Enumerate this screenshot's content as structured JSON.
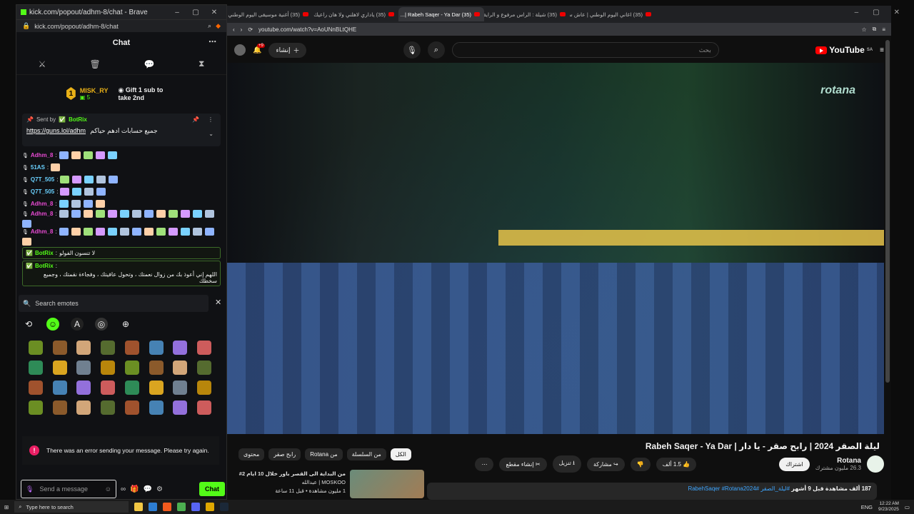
{
  "kick_window": {
    "title": "kick.com/popout/adhm-8/chat - Brave",
    "url": "kick.com/popout/adhm-8/chat"
  },
  "chat": {
    "header": "Chat",
    "gift": {
      "rank": "1",
      "user": "MISK_RY",
      "count": "5",
      "text": "Gift 1 sub to take 2nd"
    },
    "pinned": {
      "sent_by": "Sent by",
      "bot": "BotRix",
      "link": "https://guns.lol/adhm",
      "arabic": "جميع حسابات ادهم حياكم"
    },
    "messages": [
      {
        "user": "Adhm_8",
        "color": "#e64ad1",
        "emotes": 5
      },
      {
        "user": "51AS",
        "color": "#6ad1ff",
        "emotes": 1
      },
      {
        "user": "Q7T_505",
        "color": "#6ad1ff",
        "emotes": 5
      },
      {
        "user": "Q7T_505",
        "color": "#6ad1ff",
        "emotes": 4
      },
      {
        "user": "Adhm_8",
        "color": "#e64ad1",
        "emotes": 4
      },
      {
        "user": "Adhm_8",
        "color": "#e64ad1",
        "emotes": 14
      },
      {
        "user": "Adhm_8",
        "color": "#e64ad1",
        "emotes": 14
      }
    ],
    "bot_messages": [
      {
        "user": "BotRix",
        "text": "لا تنسون الفولو"
      },
      {
        "user": "BotRix",
        "text": "اللهم إني أعوذ بك من زوال نعمتك ، وتحول عافيتك ، وفجاءة نقمتك ، وجميع سخطك"
      }
    ],
    "search_emotes_placeholder": "Search emotes",
    "error": "There was an error sending your message. Please try again.",
    "input_placeholder": "Send a message",
    "send_label": "Chat"
  },
  "browser": {
    "tabs": [
      {
        "title": "(35) أغنية موسيقى اليوم الوطني السعو..."
      },
      {
        "title": "(35) ياداري لاهلني ولا هان راعيك رابح صق..."
      },
      {
        "title": "(35) Rabeh Saqer - Ya Dar |...",
        "active": true
      },
      {
        "title": "(35) شيلة : الراس مرفوع و الراية سعودية..."
      },
      {
        "title": "(35) اغاني اليوم الوطني | عاش سلمان..."
      }
    ],
    "url": "youtube.com/watch?v=AoUNnBLtQHE"
  },
  "youtube": {
    "logo": "YouTube",
    "region": "SA",
    "search_placeholder": "بحث",
    "create_label": "إنشاء",
    "notif_count": "9+",
    "video_logo": "rotana",
    "title": "ليلة الصقر 2024 | رابح صقر - يا دار | Rabeh Saqer - Ya Dar",
    "channel": "Rotana",
    "subscribers": "26.3 مليون مشترك",
    "subscribe": "اشتراك",
    "likes": "1.5 ألف",
    "share": "مشاركة",
    "download": "تنزيل",
    "clip": "إنشاء مقطع",
    "chips": [
      "الكل",
      "من السلسلة",
      "من Rotana",
      "رابح صقر",
      "محتوى"
    ],
    "rec_title": "من البداية الى القصر باور خلال 10 ايام 2#",
    "rec_channel": "MOSKOO | عبدالله",
    "rec_meta": "1 مليون مشاهدة • قبل 11 ساعة",
    "desc_views": "187 ألف مشاهدة قبل 9 أشهر",
    "desc_tags": "#ليلة_الصقر #RabehSaqer #Rotana2024"
  },
  "taskbar": {
    "search": "Type here to search",
    "lang": "ENG",
    "time": "12:22 AM",
    "date": "9/23/2025"
  }
}
